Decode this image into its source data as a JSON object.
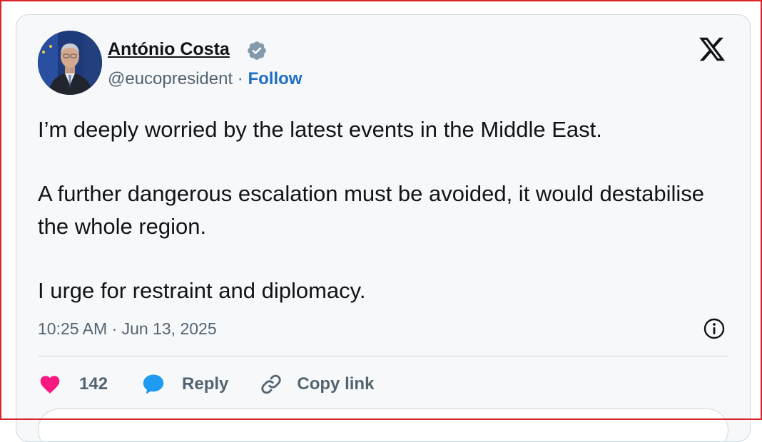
{
  "author": {
    "name": "António Costa",
    "handle": "@eucopresident",
    "separator": " · ",
    "follow_label": "Follow"
  },
  "tweet": {
    "paragraphs": [
      "I’m deeply worried by the latest events in the Middle East.",
      "A further dangerous escalation must be avoided, it would destabilise the whole region.",
      "I urge for restraint and diplomacy."
    ],
    "timestamp": "10:25 AM · Jun 13, 2025"
  },
  "actions": {
    "like_count": "142",
    "reply_label": "Reply",
    "copy_label": "Copy link"
  },
  "icons": {
    "platform_logo": "x-logo-icon",
    "verified": "verified-badge-icon",
    "info": "info-icon",
    "like": "heart-icon",
    "reply": "speech-bubble-icon",
    "copy": "link-icon"
  },
  "colors": {
    "accent": "#1d6fc4",
    "like": "#f91880",
    "reply": "#1d9bf0",
    "muted": "#536471",
    "frame": "#d9262b",
    "verified_badge": "#829aab"
  }
}
